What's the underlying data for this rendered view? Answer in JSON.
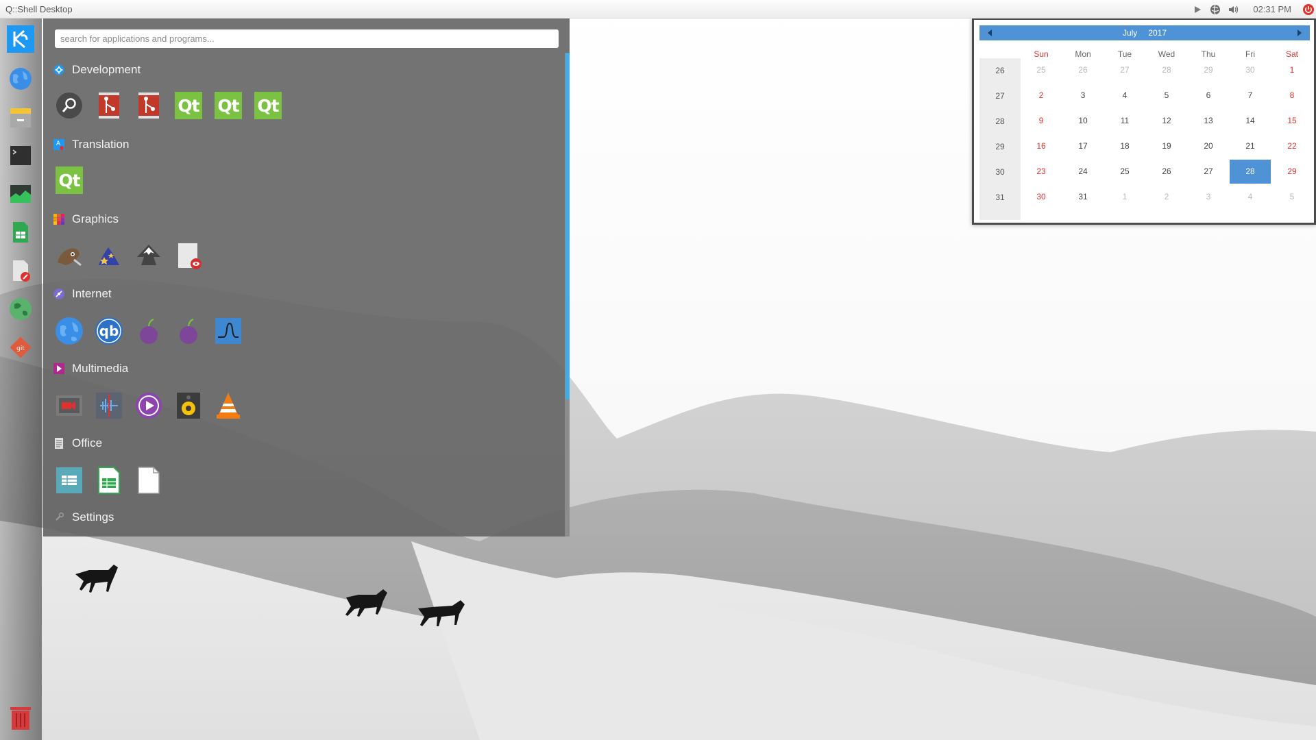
{
  "topbar": {
    "title": "Q::Shell Desktop",
    "clock": "02:31 PM",
    "tray_icons": [
      "play-icon",
      "network-globe-icon",
      "volume-icon",
      "power-icon"
    ]
  },
  "dock": {
    "items": [
      "kde-launcher-icon",
      "web-browser-icon",
      "file-archiver-icon",
      "terminal-icon",
      "system-monitor-icon",
      "spreadsheet-icon",
      "document-editor-icon",
      "network-map-icon",
      "git-icon",
      "trash-icon"
    ]
  },
  "menu": {
    "search_placeholder": "search for applications and programs...",
    "categories": [
      {
        "label": "Development",
        "apps": [
          "search-tool-icon",
          "git-gui-icon",
          "git-cola-icon",
          "qt-designer-icon",
          "qt-assistant-icon",
          "qt-creator-icon"
        ]
      },
      {
        "label": "Translation",
        "apps": [
          "qt-linguist-icon"
        ]
      },
      {
        "label": "Graphics",
        "apps": [
          "gimp-icon",
          "kolourpaint-icon",
          "inkscape-icon",
          "image-viewer-icon"
        ]
      },
      {
        "label": "Internet",
        "apps": [
          "web-browser-icon",
          "qbittorrent-icon",
          "tor-browser-icon",
          "tor-launcher-icon",
          "wireshark-icon"
        ]
      },
      {
        "label": "Multimedia",
        "apps": [
          "video-recorder-icon",
          "audio-editor-icon",
          "media-player-icon",
          "speaker-icon",
          "vlc-icon"
        ]
      },
      {
        "label": "Office",
        "apps": [
          "calc-blue-icon",
          "calc-green-icon",
          "writer-document-icon"
        ]
      },
      {
        "label": "Settings",
        "apps": []
      }
    ]
  },
  "calendar": {
    "month": "July",
    "year": "2017",
    "weekdays": [
      "Sun",
      "Mon",
      "Tue",
      "Wed",
      "Thu",
      "Fri",
      "Sat"
    ],
    "weeks": [
      {
        "num": "26",
        "days": [
          {
            "d": "25",
            "out": true
          },
          {
            "d": "26",
            "out": true
          },
          {
            "d": "27",
            "out": true
          },
          {
            "d": "28",
            "out": true
          },
          {
            "d": "29",
            "out": true
          },
          {
            "d": "30",
            "out": true
          },
          {
            "d": "1"
          }
        ]
      },
      {
        "num": "27",
        "days": [
          {
            "d": "2"
          },
          {
            "d": "3"
          },
          {
            "d": "4"
          },
          {
            "d": "5"
          },
          {
            "d": "6"
          },
          {
            "d": "7"
          },
          {
            "d": "8"
          }
        ]
      },
      {
        "num": "28",
        "days": [
          {
            "d": "9"
          },
          {
            "d": "10"
          },
          {
            "d": "11"
          },
          {
            "d": "12"
          },
          {
            "d": "13"
          },
          {
            "d": "14"
          },
          {
            "d": "15"
          }
        ]
      },
      {
        "num": "29",
        "days": [
          {
            "d": "16"
          },
          {
            "d": "17"
          },
          {
            "d": "18"
          },
          {
            "d": "19"
          },
          {
            "d": "20"
          },
          {
            "d": "21"
          },
          {
            "d": "22"
          }
        ]
      },
      {
        "num": "30",
        "days": [
          {
            "d": "23"
          },
          {
            "d": "24"
          },
          {
            "d": "25"
          },
          {
            "d": "26"
          },
          {
            "d": "27"
          },
          {
            "d": "28",
            "selected": true
          },
          {
            "d": "29"
          }
        ]
      },
      {
        "num": "31",
        "days": [
          {
            "d": "30"
          },
          {
            "d": "31"
          },
          {
            "d": "1",
            "out": true
          },
          {
            "d": "2",
            "out": true
          },
          {
            "d": "3",
            "out": true
          },
          {
            "d": "4",
            "out": true
          },
          {
            "d": "5",
            "out": true
          }
        ]
      }
    ]
  },
  "colors": {
    "accent": "#3daee9",
    "calendar_header": "#4f92d6",
    "weekend": "#e03131",
    "qt_green": "#7cc242"
  }
}
